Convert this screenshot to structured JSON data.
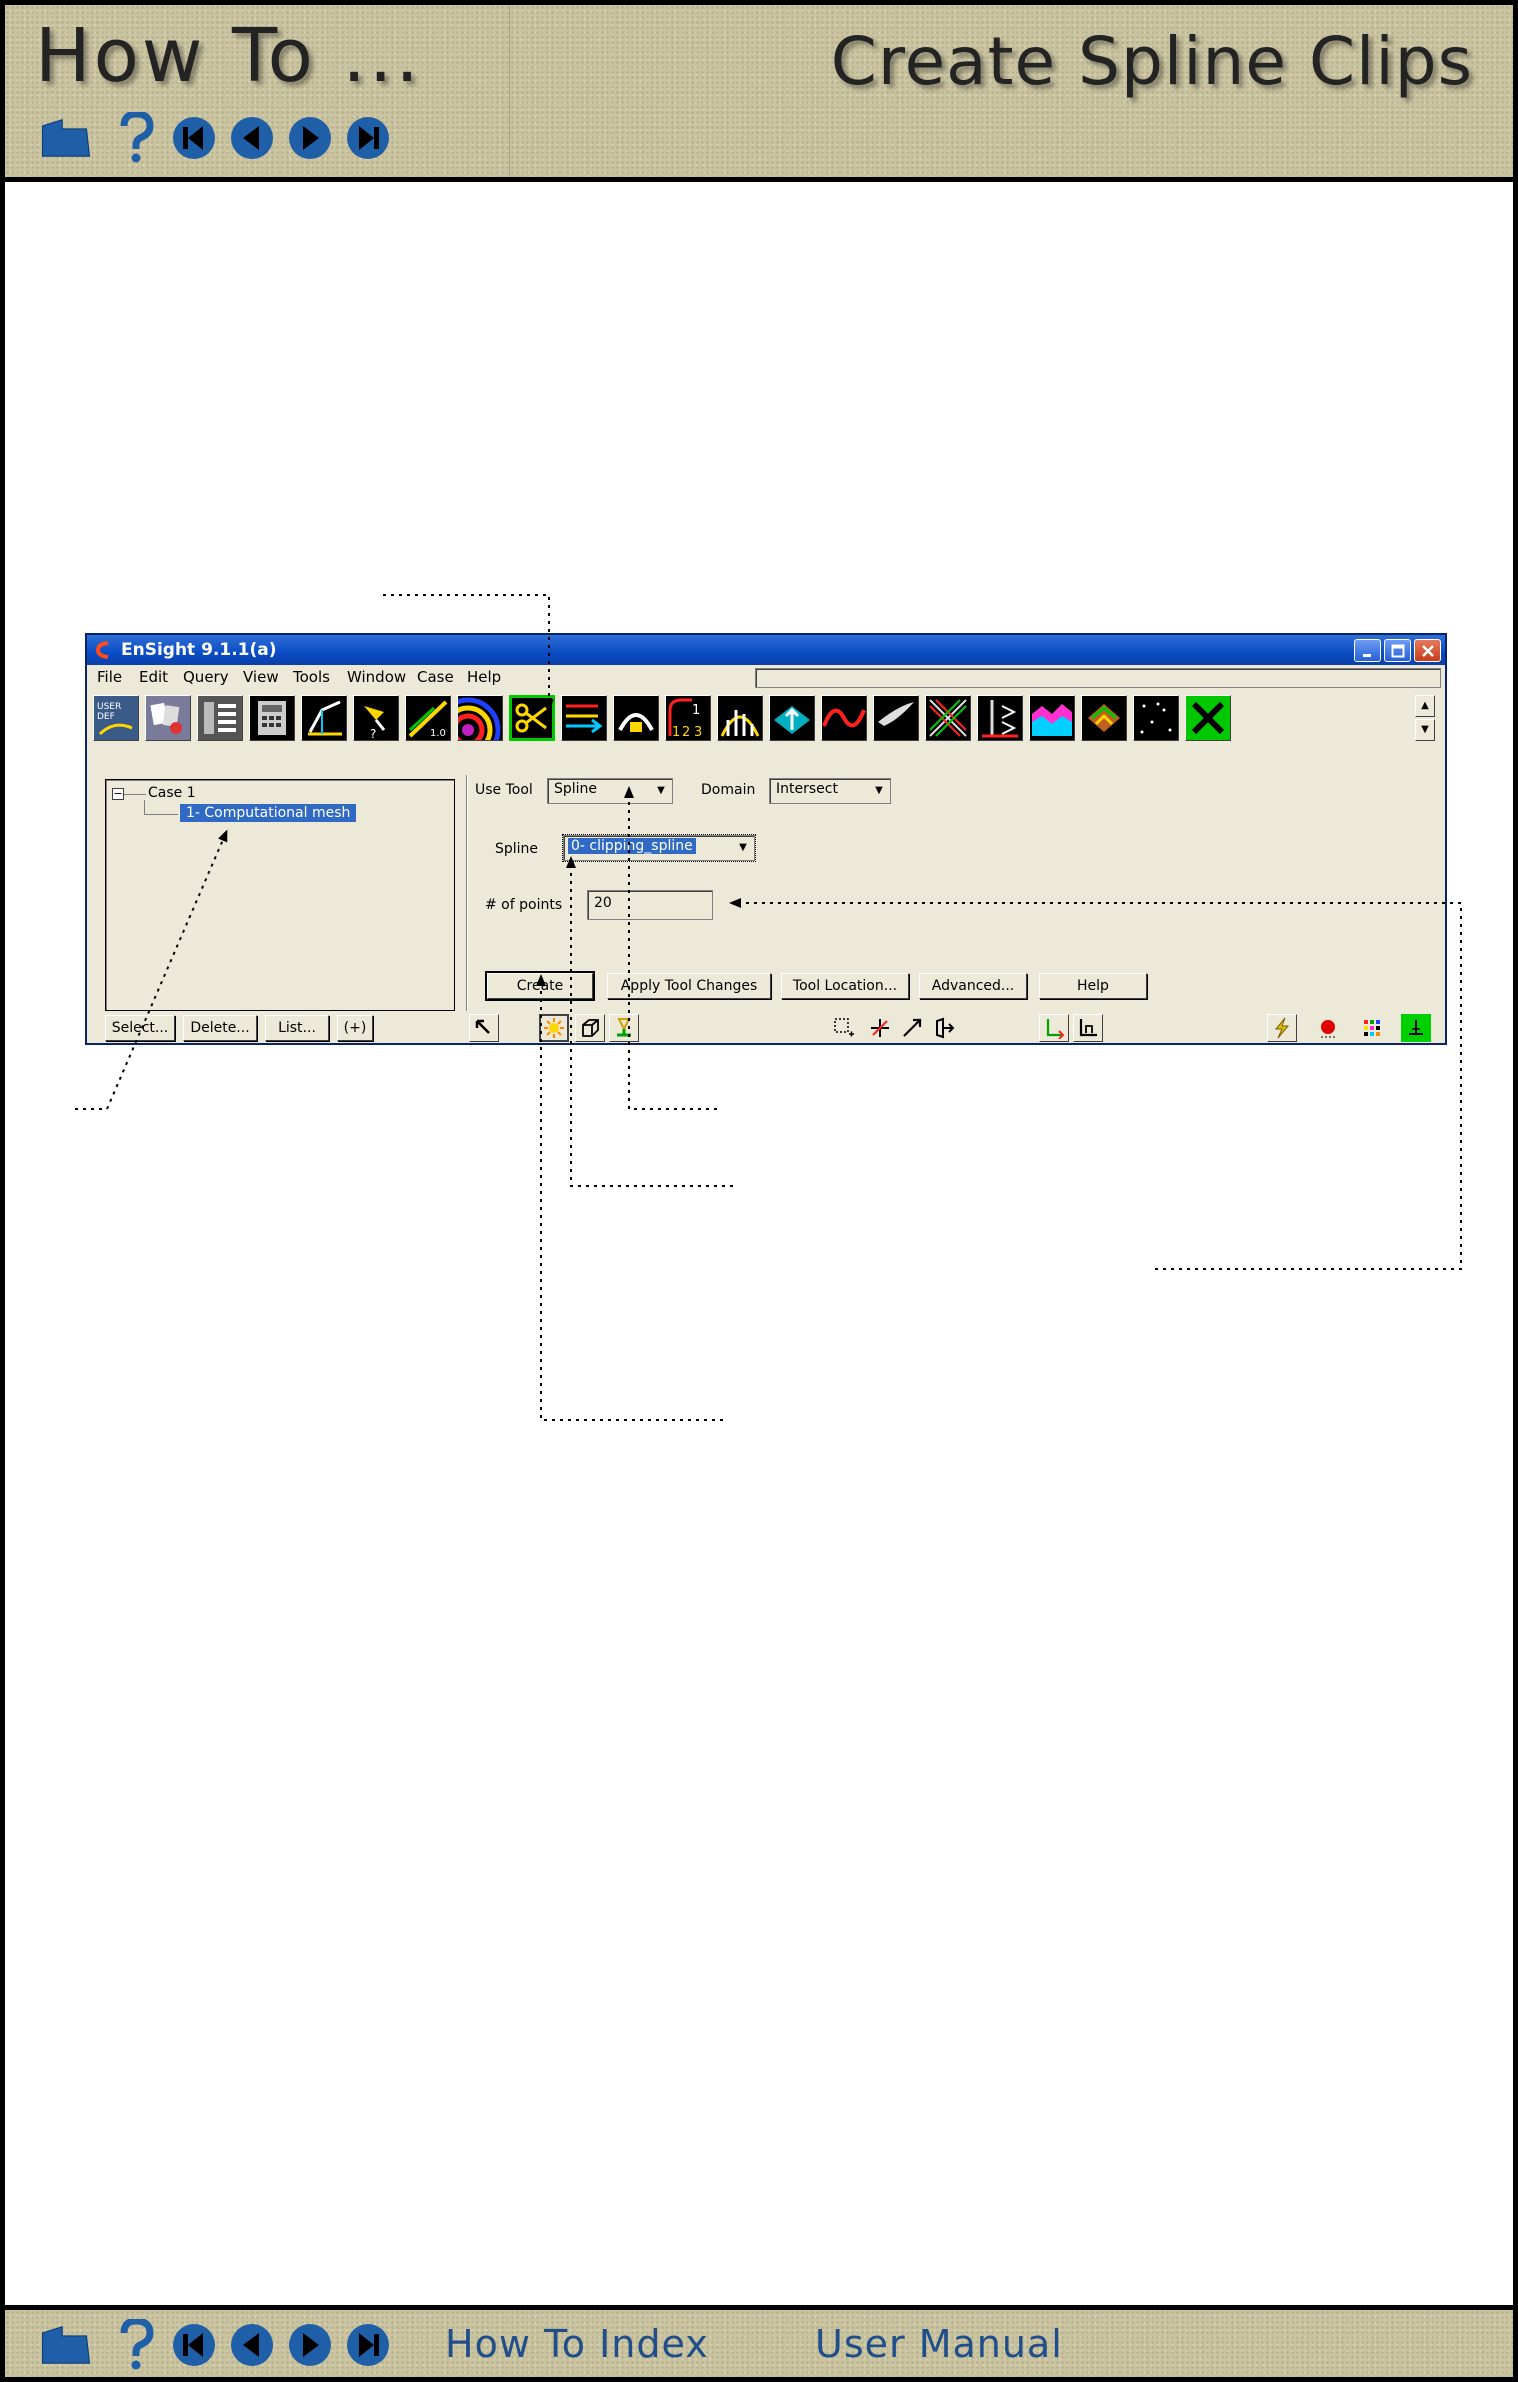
{
  "header": {
    "howto": "How To ...",
    "title": "Create Spline Clips",
    "nav_icons": [
      "home-icon",
      "help-icon",
      "first-page-icon",
      "previous-page-icon",
      "next-page-icon",
      "last-page-icon"
    ]
  },
  "footer": {
    "nav_icons": [
      "home-icon",
      "help-icon",
      "first-page-icon",
      "previous-page-icon",
      "next-page-icon",
      "last-page-icon"
    ],
    "howto_index": "How To Index",
    "user_manual": "User Manual"
  },
  "window": {
    "title": "EnSight 9.1.1(a)",
    "menu": [
      "File",
      "Edit",
      "Query",
      "View",
      "Tools",
      "Window",
      "Case",
      "Help"
    ],
    "toolbar_tools": [
      "user-defined-tool-icon",
      "create-parts-icon",
      "parts-list-icon",
      "calculator-icon",
      "elevated-surface-icon",
      "query-probe-icon",
      "line-plot-icon",
      "contour-icon",
      "clip-tool-icon",
      "vector-arrows-icon",
      "isosurface-icon",
      "tensor-glyph-icon",
      "particle-trace-icon",
      "profile-icon",
      "separation-line-icon",
      "vortex-core-icon",
      "shock-surface-icon",
      "subset-icon",
      "material-icon",
      "point-part-icon",
      "extract-icon",
      "discard-icon"
    ],
    "active_tool": "clip-tool-icon",
    "tree": {
      "case": "Case 1",
      "part": "1- Computational mesh"
    },
    "left_buttons": [
      "Select...",
      "Delete...",
      "List...",
      "(+)"
    ],
    "clip": {
      "use_tool_label": "Use Tool",
      "use_tool_value": "Spline",
      "domain_label": "Domain",
      "domain_value": "Intersect",
      "spline_label": "Spline",
      "spline_value": "0- clipping_spline",
      "points_label": "# of points",
      "points_value": "20"
    },
    "action_buttons": [
      "Create",
      "Apply Tool Changes",
      "Tool Location...",
      "Advanced...",
      "Help"
    ],
    "bottom_tools": [
      "selection-mode-icon",
      "part-mode-icon",
      "frame-mode-icon",
      "tool-mode-icon",
      "region-select-icon",
      "cursor-tool-icon",
      "line-tool-icon",
      "plane-tool-icon",
      "xyz-axis-icon",
      "annotation-axis-icon",
      "lightning-icon",
      "record-icon",
      "grid-dots-icon",
      "mesh-plot-icon"
    ]
  }
}
